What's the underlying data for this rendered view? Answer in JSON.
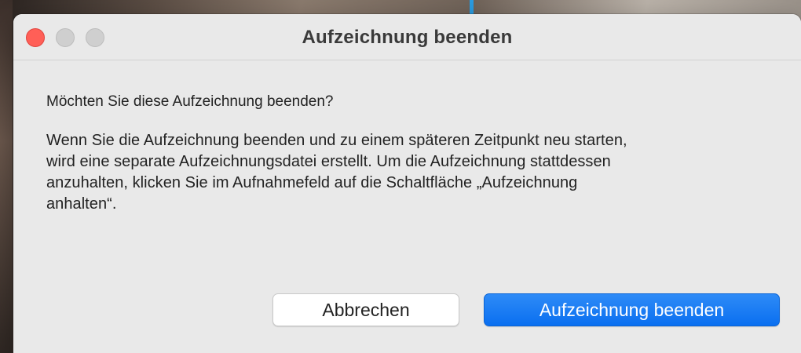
{
  "window": {
    "title": "Aufzeichnung beenden"
  },
  "dialog": {
    "question": "Möchten Sie diese Aufzeichnung beenden?",
    "body_lines": [
      "Wenn Sie die Aufzeichnung beenden und zu einem späteren Zeitpunkt neu starten,",
      "wird eine separate Aufzeichnungsdatei erstellt. Um die Aufzeichnung stattdessen",
      "anzuhalten, klicken Sie im Aufnahmefeld auf die Schaltfläche „Aufzeichnung",
      "anhalten“."
    ]
  },
  "buttons": {
    "cancel_label": "Abbrechen",
    "confirm_label": "Aufzeichnung beenden"
  },
  "colors": {
    "accent": "#0a6ff0",
    "close_light": "#ff5f57",
    "inactive_light": "#cfcfcf",
    "dialog_bg": "#e9e9e9"
  }
}
